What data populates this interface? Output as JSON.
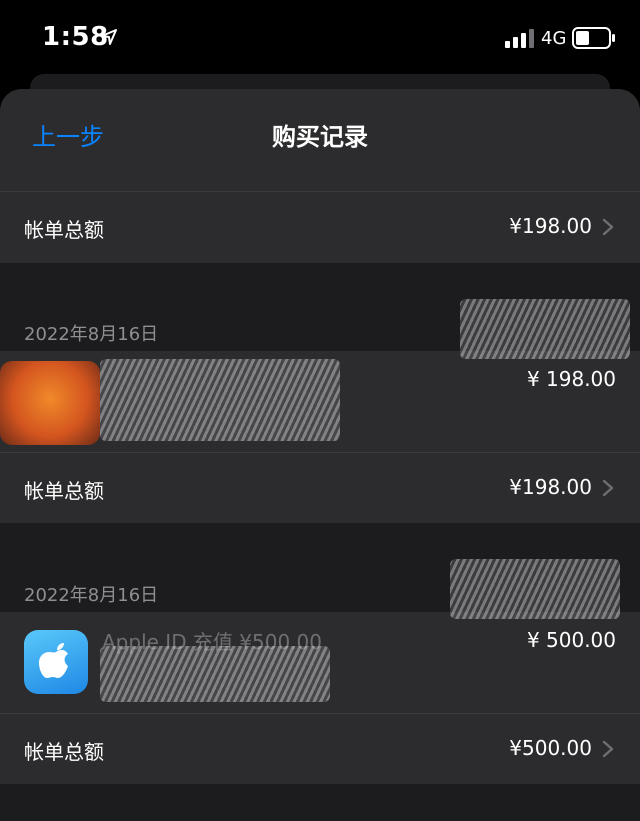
{
  "status_bar": {
    "time": "1:58",
    "network": "4G"
  },
  "nav": {
    "back_label": "上一步",
    "title": "购买记录"
  },
  "sections": [
    {
      "total_label": "帐单总额",
      "total_amount": "¥198.00"
    },
    {
      "date": "2022年8月16日",
      "item_name": "",
      "item_amount": "¥ 198.00",
      "total_label": "帐单总额",
      "total_amount": "¥198.00"
    },
    {
      "date": "2022年8月16日",
      "item_name": "Apple ID 充值 ¥500.00",
      "item_amount": "¥ 500.00",
      "total_label": "帐单总额",
      "total_amount": "¥500.00"
    }
  ],
  "colors": {
    "accent": "#0a84ff",
    "sheet_bg": "#1c1c1e",
    "row_bg": "#2c2c2e",
    "secondary_text": "#8e8e93"
  }
}
